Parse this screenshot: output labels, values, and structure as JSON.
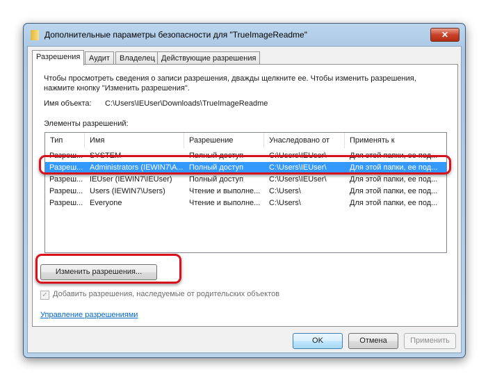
{
  "window": {
    "title": "Дополнительные параметры безопасности  для \"TrueImageReadme\"",
    "close": "✕"
  },
  "tabs": [
    "Разрешения",
    "Аудит",
    "Владелец",
    "Действующие разрешения"
  ],
  "info": "Чтобы просмотреть сведения о записи разрешения, дважды щелкните ее. Чтобы изменить разрешения,",
  "info2": "нажмите кнопку \"Изменить разрешения\".",
  "object_label": "Имя объекта:",
  "object_path": "C:\\Users\\IEUser\\Downloads\\TrueImageReadme",
  "entries_label": "Элементы разрешений:",
  "columns": [
    "Тип",
    "Имя",
    "Разрешение",
    "Унаследовано от",
    "Применять к"
  ],
  "rows": [
    [
      "Разреш...",
      "SYSTEM",
      "Полный доступ",
      "C:\\Users\\IEUser\\",
      "Для этой папки, ее под..."
    ],
    [
      "Разреш...",
      "Administrators (IEWIN7\\A...",
      "Полный доступ",
      "C:\\Users\\IEUser\\",
      "Для этой папки, ее под..."
    ],
    [
      "Разреш...",
      "IEUser (IEWIN7\\IEUser)",
      "Полный доступ",
      "C:\\Users\\IEUser\\",
      "Для этой папки, ее под..."
    ],
    [
      "Разреш...",
      "Users (IEWIN7\\Users)",
      "Чтение и выполне...",
      "C:\\Users\\",
      "Для этой папки, ее под..."
    ],
    [
      "Разреш...",
      "Everyone",
      "Чтение и выполне...",
      "C:\\Users\\",
      "Для этой папки, ее под..."
    ]
  ],
  "edit_button": "Изменить разрешения...",
  "inherit_checkbox": "Добавить разрешения, наследуемые от родительских объектов",
  "manage_link": "Управление разрешениями",
  "buttons": {
    "ok": "OK",
    "cancel": "Отмена",
    "apply": "Применить"
  }
}
